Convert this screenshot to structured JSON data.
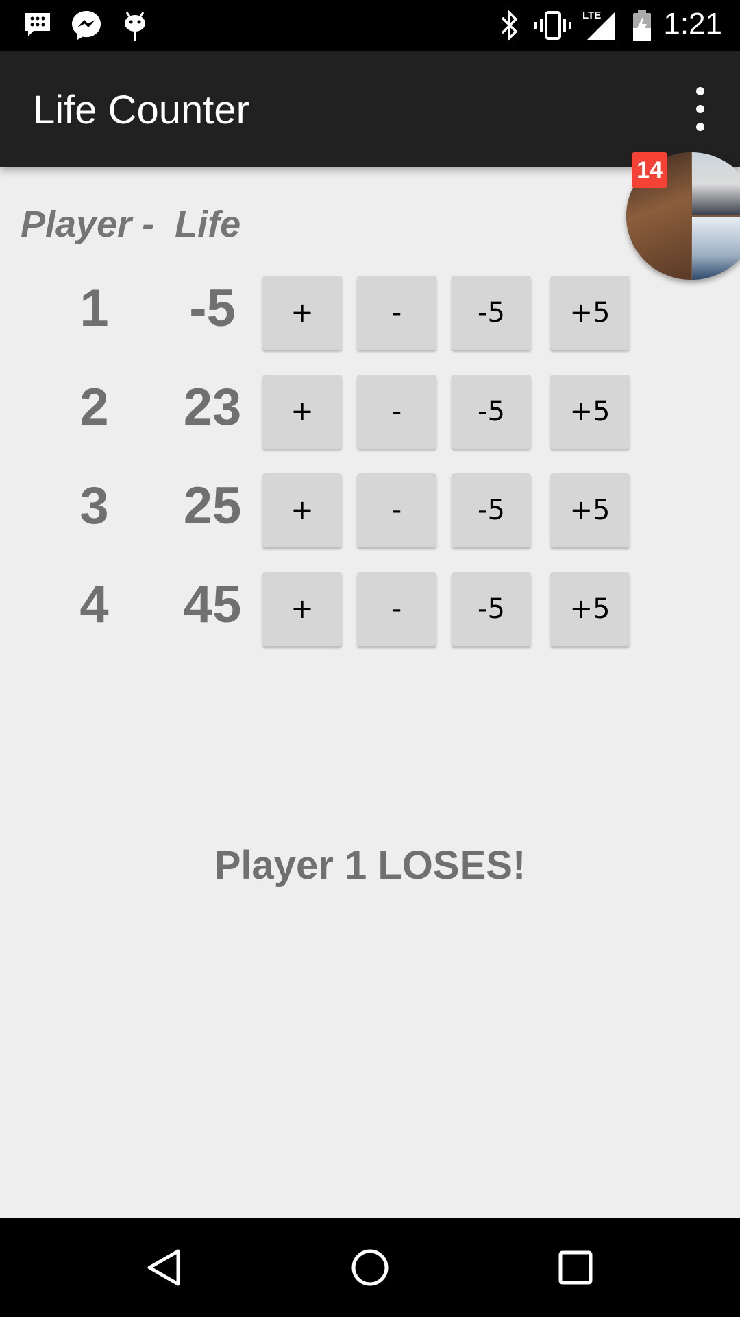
{
  "status_bar": {
    "time": "1:21",
    "network": "LTE",
    "icons": [
      "blackberry-messenger-icon",
      "messenger-icon",
      "android-debug-icon",
      "bluetooth-icon",
      "vibrate-icon",
      "signal-icon",
      "battery-icon"
    ]
  },
  "app_bar": {
    "title": "Life Counter",
    "menu_icon": "overflow-menu-icon"
  },
  "table": {
    "header": "Player -  Life",
    "players": [
      {
        "number": "1",
        "life": "-5"
      },
      {
        "number": "2",
        "life": "23"
      },
      {
        "number": "3",
        "life": "25"
      },
      {
        "number": "4",
        "life": "45"
      }
    ],
    "buttons": [
      "+",
      "-",
      "-5",
      "+5"
    ]
  },
  "result_text": "Player 1 LOSES!",
  "chat_head": {
    "badge_count": "14"
  },
  "nav_bar": {
    "icons": [
      "back-icon",
      "home-icon",
      "recents-icon"
    ]
  },
  "colors": {
    "app_bar": "#212121",
    "background": "#eeeeee",
    "button": "#d6d6d6",
    "text_gray": "#707070",
    "badge": "#f44336"
  }
}
